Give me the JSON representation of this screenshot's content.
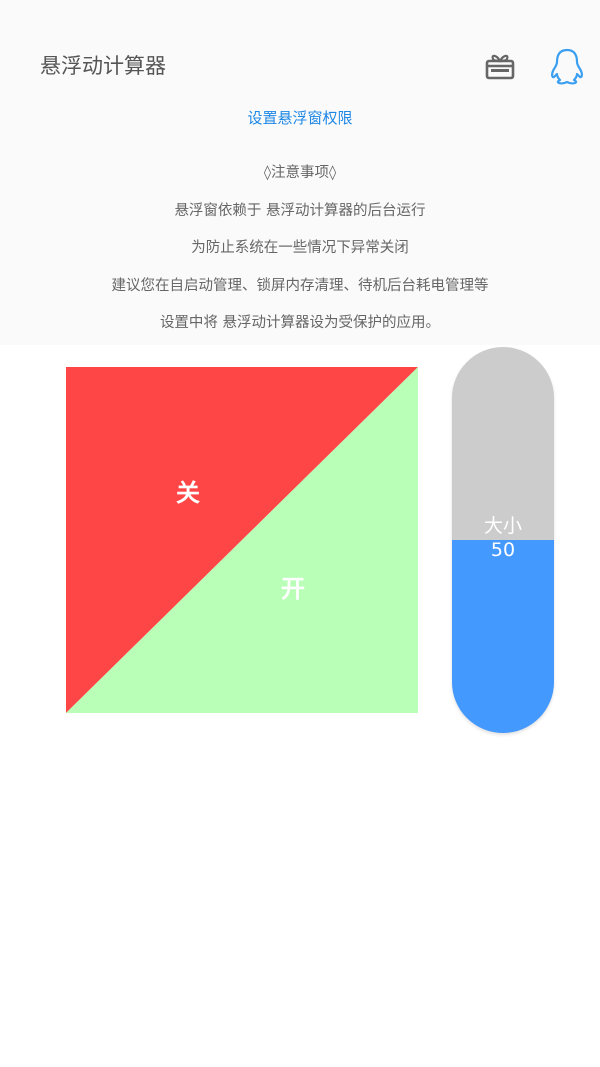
{
  "header": {
    "title": "悬浮动计算器",
    "gift_icon": "gift-box-icon",
    "qq_icon": "qq-penguin-icon"
  },
  "permission_link": "设置悬浮窗权限",
  "notice": {
    "heading": "◊注意事项◊",
    "lines": [
      "悬浮窗依赖于 悬浮动计算器的后台运行",
      "为防止系统在一些情况下异常关闭",
      "建议您在自启动管理、锁屏内存清理、待机后台耗电管理等",
      "设置中将 悬浮动计算器设为受保护的应用。"
    ]
  },
  "toggle": {
    "off_label": "关",
    "on_label": "开",
    "off_color": "#ff4646",
    "on_color": "#baffb8"
  },
  "size_slider": {
    "label": "大小",
    "value": "50",
    "fill_fraction": 0.5,
    "track_color": "#cccccc",
    "fill_color": "#4499ff"
  }
}
